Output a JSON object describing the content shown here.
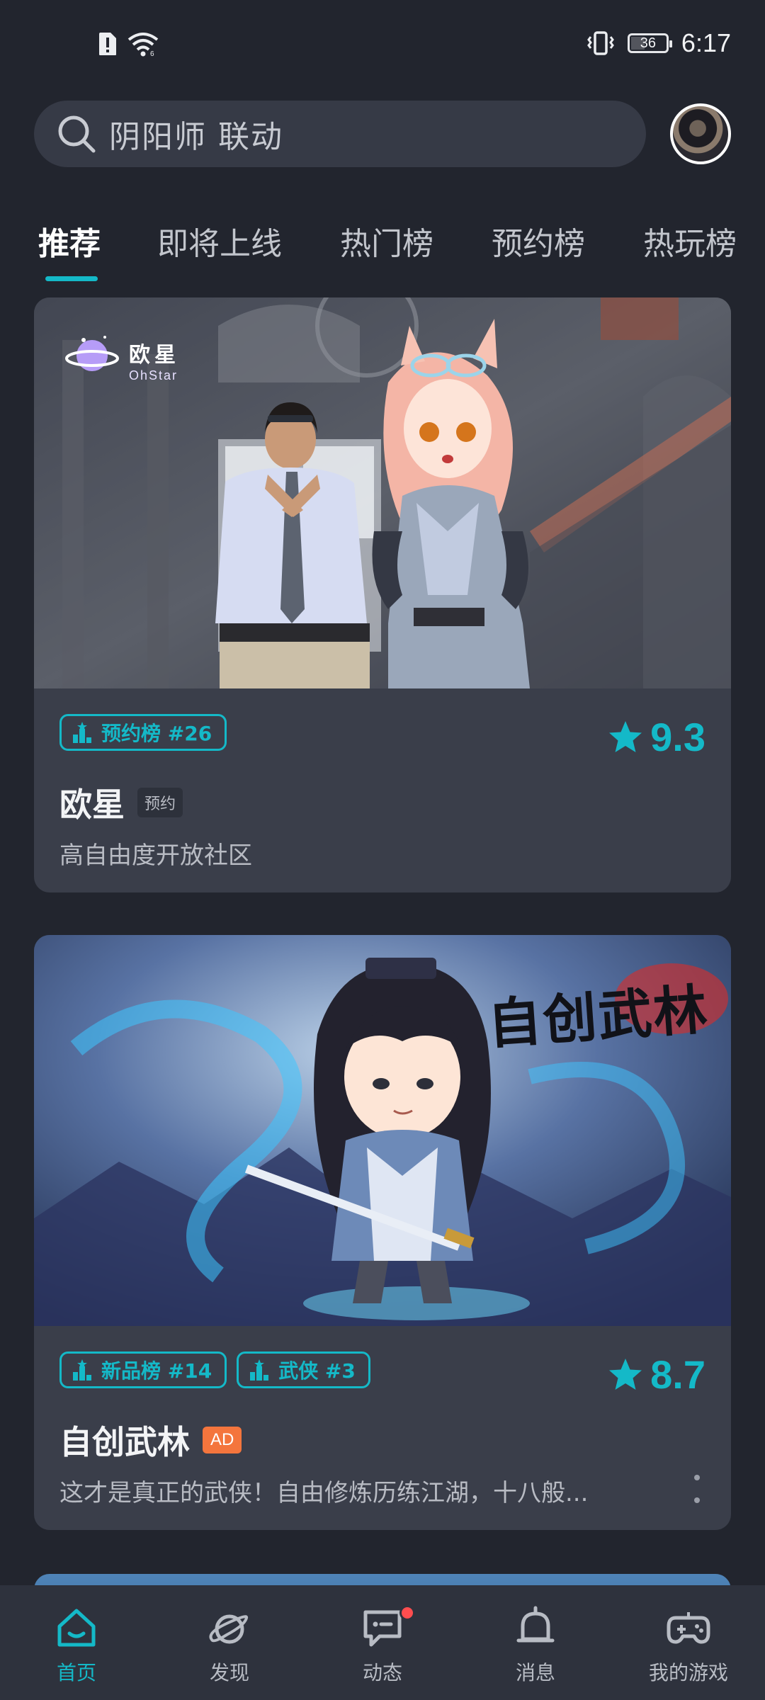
{
  "status_bar": {
    "time": "6:17",
    "battery_level": "36",
    "left_icons": [
      "sim-alert-icon",
      "wifi-icon"
    ],
    "right_icons": [
      "vibrate-icon",
      "battery-icon"
    ]
  },
  "search": {
    "text": "阴阳师 联动",
    "icon": "search-icon"
  },
  "tabs": [
    {
      "label": "推荐",
      "active": true
    },
    {
      "label": "即将上线"
    },
    {
      "label": "热门榜"
    },
    {
      "label": "预约榜"
    },
    {
      "label": "热玩榜"
    }
  ],
  "cards": [
    {
      "banner_logo": {
        "name": "欧星",
        "subtitle": "OhStar"
      },
      "tags": [
        "预约榜 #26"
      ],
      "rating": "9.3",
      "title": "欧星",
      "badge": "预约",
      "description": "高自由度开放社区"
    },
    {
      "banner_logo": {
        "name": "自创武林"
      },
      "tags": [
        "新品榜 #14",
        "武侠 #3"
      ],
      "rating": "8.7",
      "title": "自创武林",
      "badge": "AD",
      "description": "这才是真正的武侠！自由修炼历练江湖，十八般..."
    }
  ],
  "bottom_nav": [
    {
      "label": "首页",
      "icon": "home-icon",
      "active": true
    },
    {
      "label": "发现",
      "icon": "discover-planet-icon"
    },
    {
      "label": "动态",
      "icon": "chat-bubble-icon",
      "has_notification": true
    },
    {
      "label": "消息",
      "icon": "bell-icon"
    },
    {
      "label": "我的游戏",
      "icon": "gamepad-icon"
    }
  ],
  "colors": {
    "background": "#22252e",
    "card": "#3a3e4a",
    "accent": "#14b9c8",
    "ad_badge": "#f4753d",
    "notification_dot": "#ff4d4f"
  }
}
